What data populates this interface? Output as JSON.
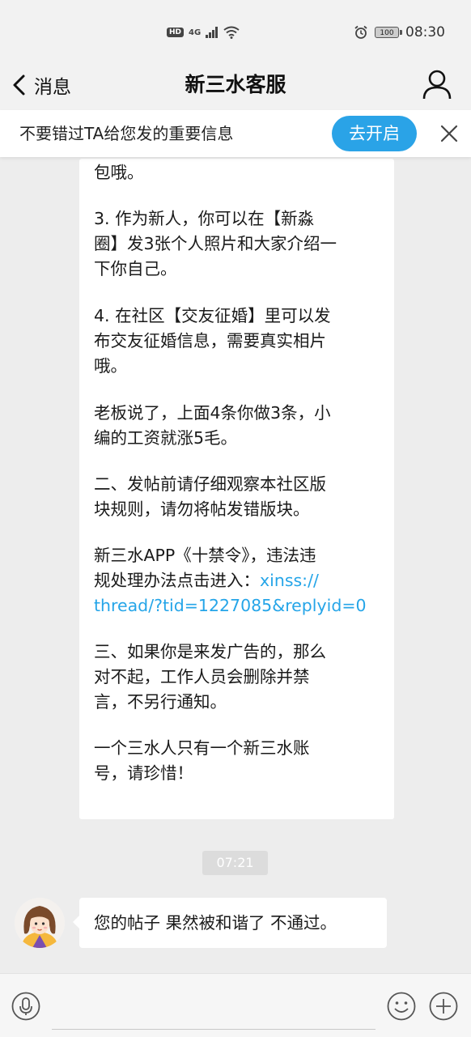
{
  "status_bar": {
    "hd_badge": "HD",
    "network": "4G",
    "battery_level": "100",
    "time": "08:30"
  },
  "nav": {
    "back_label": "消息",
    "title": "新三水客服"
  },
  "notice": {
    "text": "不要错过TA给您发的重要信息",
    "button_label": "去开启"
  },
  "message_card": {
    "paragraphs": [
      "包哦。",
      "3. 作为新人，你可以在【新淼\n圈】发3张个人照片和大家介绍一\n下你自己。",
      "4. 在社区【交友征婚】里可以发\n布交友征婚信息，需要真实相片\n哦。",
      "老板说了，上面4条你做3条，小\n编的工资就涨5毛。",
      "二、发帖前请仔细观察本社区版\n块规则，请勿将帖发错版块。",
      "三、如果你是来发广告的，那么\n对不起，工作人员会删除并禁\n言，不另行通知。",
      "一个三水人只有一个新三水账\n号，请珍惜！"
    ],
    "rule_para_prefix": "新三水APP《十禁令》，违法违\n规处理办法点击进入：",
    "rule_link": "xinss://\nthread/?tid=1227085&replyid=0"
  },
  "timestamp": "07:21",
  "reply": {
    "text": "您的帖子 果然被和谐了 不通过。"
  },
  "input": {
    "placeholder": ""
  },
  "colors": {
    "accent": "#2aa3e7",
    "link": "#25a5e8",
    "background": "#ededed"
  }
}
